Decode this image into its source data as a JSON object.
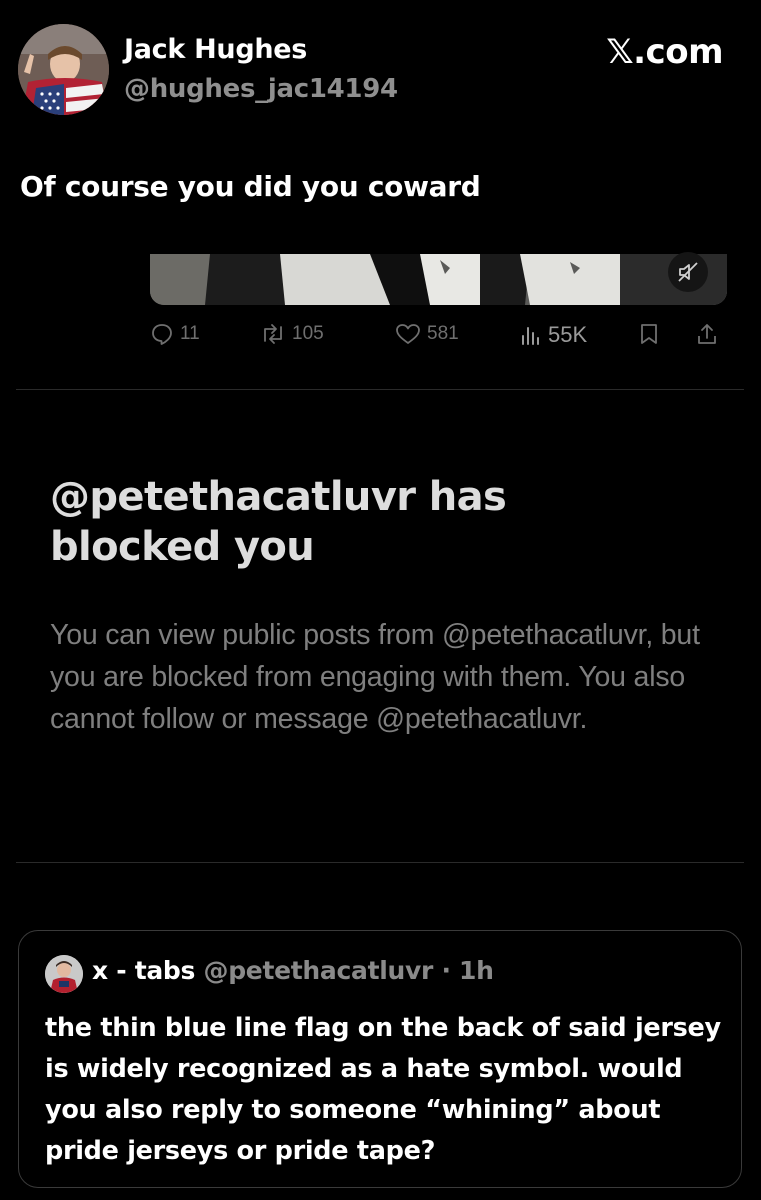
{
  "author": {
    "name": "Jack Hughes",
    "handle": "@hughes_jac14194"
  },
  "brand": "𝕏.com",
  "tweet": {
    "text": "Of course you did you coward"
  },
  "stats": {
    "replies": "11",
    "reposts": "105",
    "likes": "581",
    "views": "55K"
  },
  "block_notice": {
    "title": "@petethacatluvr has blocked you",
    "body": "You can view public posts from @petethacatluvr, but you are blocked from engaging with them. You also cannot follow or message @petethacatluvr."
  },
  "quoted": {
    "name": "x - tabs",
    "handle": "@petethacatluvr",
    "time": "· 1h",
    "text": "the thin blue line flag on the back of said jersey is widely recognized as a hate symbol. would you also reply to someone “whining” about pride jerseys or pride tape?"
  },
  "colors": {
    "background": "#000000",
    "text": "#ffffff",
    "muted": "#8f8f8f",
    "icon": "#6f6f6f",
    "border": "#3a3a3a"
  },
  "icons": {
    "reply": "reply-icon",
    "repost": "repost-icon",
    "like": "heart-icon",
    "views": "views-icon",
    "bookmark": "bookmark-icon",
    "share": "share-icon",
    "mute": "muted-speaker-icon"
  }
}
